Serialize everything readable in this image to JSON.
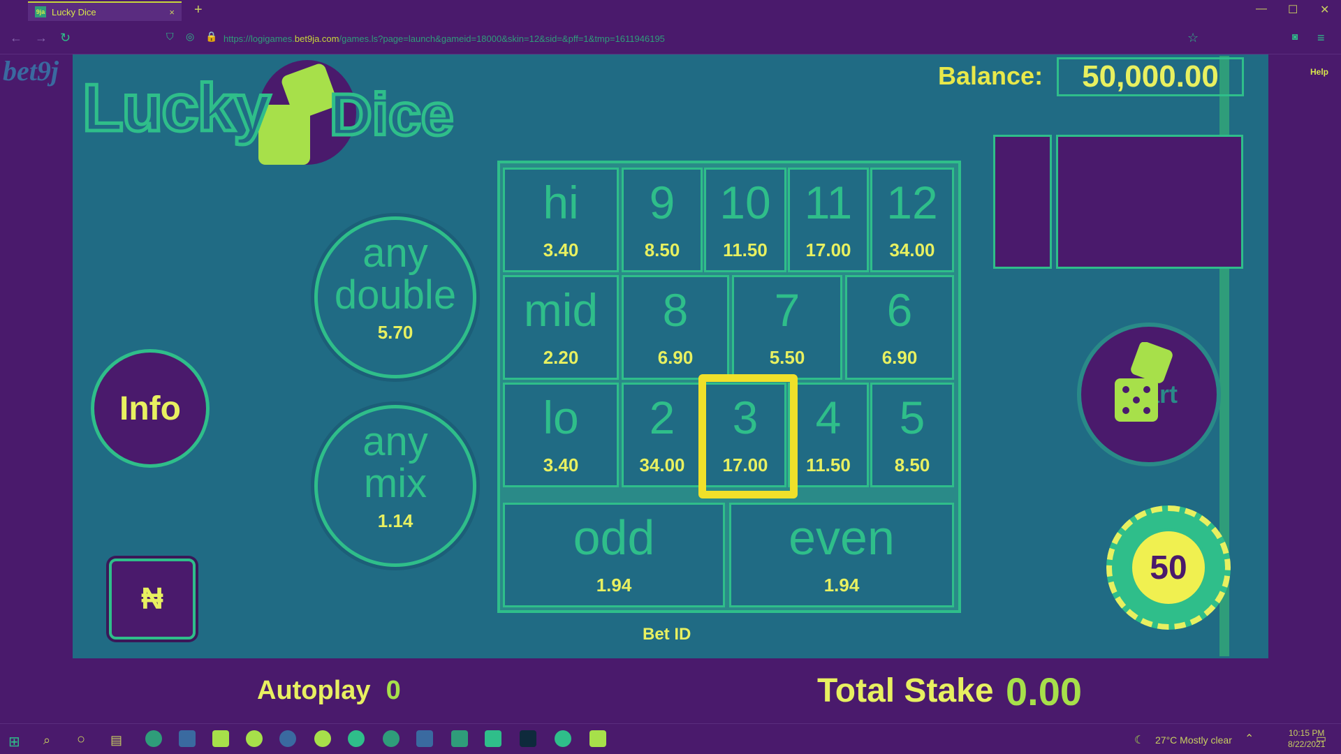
{
  "browser": {
    "tab_title": "Lucky Dice",
    "tab_favicon_text": "9ja",
    "tab_close": "×",
    "new_tab": "+",
    "url_prefix": "https://logigames.",
    "url_domain": "bet9ja.com",
    "url_suffix": "/games.ls?page=launch&gameid=18000&skin=12&sid=&pff=1&tmp=1611946195",
    "window_controls": [
      "—",
      "☐",
      "✕"
    ]
  },
  "site": {
    "logo": "bet9j",
    "help": "Help"
  },
  "game": {
    "title_left": "Lucky",
    "title_right": "Dice",
    "balance_label": "Balance:",
    "balance_value": "50,000.00",
    "circles": [
      {
        "line1": "any",
        "line2": "double",
        "odds": "5.70"
      },
      {
        "line1": "any",
        "line2": "mix",
        "odds": "1.14"
      }
    ],
    "board": {
      "row1": [
        {
          "label": "hi",
          "odds": "3.40"
        },
        {
          "label": "9",
          "odds": "8.50"
        },
        {
          "label": "10",
          "odds": "11.50"
        },
        {
          "label": "11",
          "odds": "17.00"
        },
        {
          "label": "12",
          "odds": "34.00"
        }
      ],
      "row2": [
        {
          "label": "mid",
          "odds": "2.20"
        },
        {
          "label": "8",
          "odds": "6.90"
        },
        {
          "label": "7",
          "odds": "5.50"
        },
        {
          "label": "6",
          "odds": "6.90"
        }
      ],
      "row3": [
        {
          "label": "lo",
          "odds": "3.40"
        },
        {
          "label": "2",
          "odds": "34.00"
        },
        {
          "label": "3",
          "odds": "17.00"
        },
        {
          "label": "4",
          "odds": "11.50"
        },
        {
          "label": "5",
          "odds": "8.50"
        }
      ],
      "row4": [
        {
          "label": "odd",
          "odds": "1.94"
        },
        {
          "label": "even",
          "odds": "1.94"
        }
      ]
    },
    "info_label": "Info",
    "currency_symbol": "₦",
    "bet_id_label": "Bet ID",
    "start_label": "Start",
    "chip_value": "50",
    "autoplay_label": "Autoplay",
    "autoplay_value": "0",
    "total_stake_label": "Total Stake",
    "total_stake_value": "0.00"
  },
  "taskbar": {
    "weather": "27°C  Mostly clear",
    "time": "10:15 PM",
    "date": "8/22/2021"
  },
  "colors": {
    "frame": "#4a1a6c",
    "table": "#206b84",
    "accent": "#2fbe8a",
    "text_highlight": "#e8f060",
    "selection": "#f0e02a"
  }
}
